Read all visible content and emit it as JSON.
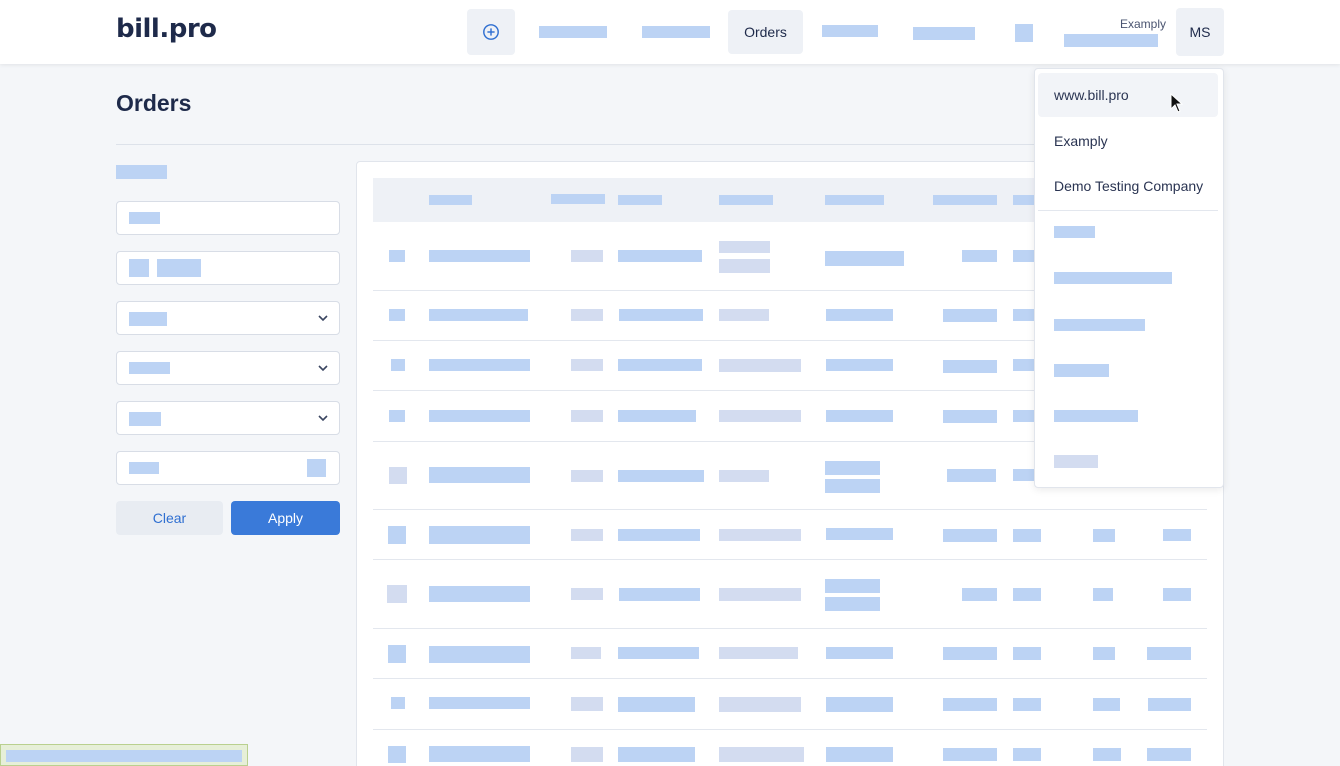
{
  "header": {
    "logo": "bill.pro",
    "nav_active": "Orders",
    "company_label": "Examply",
    "avatar_initials": "MS"
  },
  "page": {
    "title": "Orders"
  },
  "filters": {
    "clear_label": "Clear",
    "apply_label": "Apply"
  },
  "company_menu": {
    "items": [
      "www.bill.pro",
      "Examply",
      "Demo Testing Company"
    ]
  },
  "colors": {
    "accent": "#3a7ad9",
    "placeholder": "#bcd3f4"
  },
  "icons": {
    "add": "plus-circle-icon",
    "dropdown": "chevron-down-icon",
    "pointer": "mouse-cursor-icon"
  }
}
